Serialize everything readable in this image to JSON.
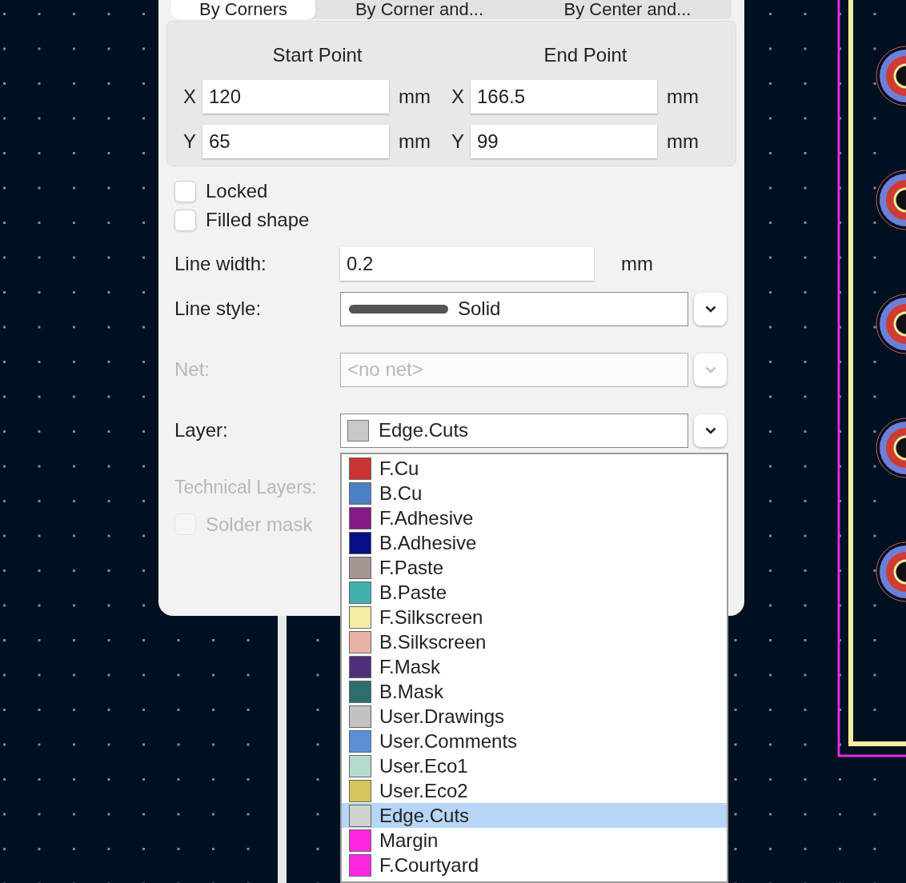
{
  "tabs": [
    {
      "label": "By Corners",
      "selected": true
    },
    {
      "label": "By Corner and...",
      "selected": false
    },
    {
      "label": "By Center and...",
      "selected": false
    }
  ],
  "points": [
    {
      "title": "Start Point",
      "fields": [
        {
          "label": "X",
          "value": "120",
          "unit": "mm"
        },
        {
          "label": "Y",
          "value": "65",
          "unit": "mm"
        }
      ]
    },
    {
      "title": "End Point",
      "fields": [
        {
          "label": "X",
          "value": "166.5",
          "unit": "mm"
        },
        {
          "label": "Y",
          "value": "99",
          "unit": "mm"
        }
      ]
    }
  ],
  "checkboxes": [
    {
      "label": "Locked",
      "checked": false
    },
    {
      "label": "Filled shape",
      "checked": false
    }
  ],
  "line_width": {
    "label": "Line width:",
    "value": "0.2",
    "unit": "mm"
  },
  "line_style": {
    "label": "Line style:",
    "value": "Solid"
  },
  "net": {
    "label": "Net:",
    "placeholder": "<no net>",
    "disabled": true
  },
  "layer": {
    "label": "Layer:",
    "value": "Edge.Cuts",
    "color": "#c8c8c8"
  },
  "technical_layers": {
    "label": "Technical Layers:",
    "disabled": true,
    "options": [
      {
        "label": "Solder mask",
        "checked": false
      }
    ]
  },
  "layer_list": [
    {
      "label": "F.Cu",
      "color": "#c83434",
      "selected": false
    },
    {
      "label": "B.Cu",
      "color": "#4d7fc4",
      "selected": false
    },
    {
      "label": "F.Adhesive",
      "color": "#841b84",
      "selected": false
    },
    {
      "label": "B.Adhesive",
      "color": "#050e84",
      "selected": false
    },
    {
      "label": "F.Paste",
      "color": "#a59591",
      "selected": false
    },
    {
      "label": "B.Paste",
      "color": "#3fb0ad",
      "selected": false
    },
    {
      "label": "F.Silkscreen",
      "color": "#f2eda1",
      "selected": false
    },
    {
      "label": "B.Silkscreen",
      "color": "#e8b2a7",
      "selected": false
    },
    {
      "label": "F.Mask",
      "color": "#4f2f7c",
      "selected": false
    },
    {
      "label": "B.Mask",
      "color": "#2c6e6c",
      "selected": false
    },
    {
      "label": "User.Drawings",
      "color": "#c2c2c2",
      "selected": false
    },
    {
      "label": "User.Comments",
      "color": "#5a8fd6",
      "selected": false
    },
    {
      "label": "User.Eco1",
      "color": "#b5dbd0",
      "selected": false
    },
    {
      "label": "User.Eco2",
      "color": "#d6c45c",
      "selected": false
    },
    {
      "label": "Edge.Cuts",
      "color": "#d0d2cd",
      "selected": true
    },
    {
      "label": "Margin",
      "color": "#ff26e2",
      "selected": false
    },
    {
      "label": "F.Courtyard",
      "color": "#ff26e2",
      "selected": false
    }
  ]
}
